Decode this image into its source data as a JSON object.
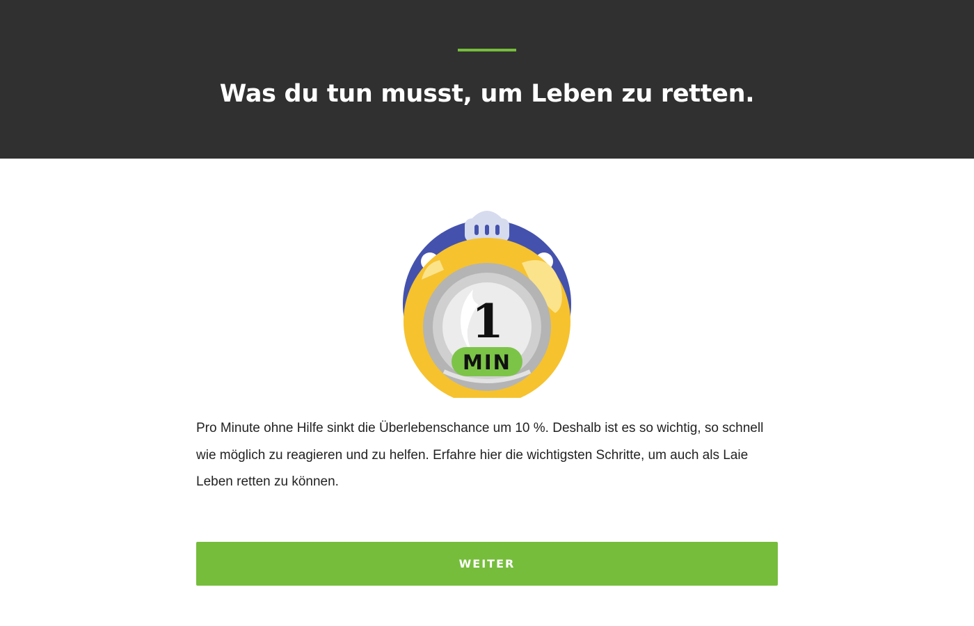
{
  "header": {
    "title": "Was du tun musst, um Leben zu retten."
  },
  "illustration": {
    "icon": "stopwatch-icon",
    "number": "1",
    "unit": "MIN"
  },
  "intro": {
    "text": "Pro Minute ohne Hilfe sinkt die Überlebenschance um 10 %. Deshalb ist es so wichtig, so schnell wie möglich zu reagieren und zu helfen. Erfahre hier die wichtigsten Schritte, um auch als Laie Leben retten zu können."
  },
  "actions": {
    "next_label": "WEITER"
  },
  "colors": {
    "header_bg": "#303030",
    "accent": "#76bd3c",
    "button_bg": "#76bd3c",
    "text": "#222222",
    "icon_blue": "#4452ad",
    "icon_yellow": "#f6c22e",
    "icon_silver": "#b4b4b4",
    "icon_face": "#ececec"
  }
}
